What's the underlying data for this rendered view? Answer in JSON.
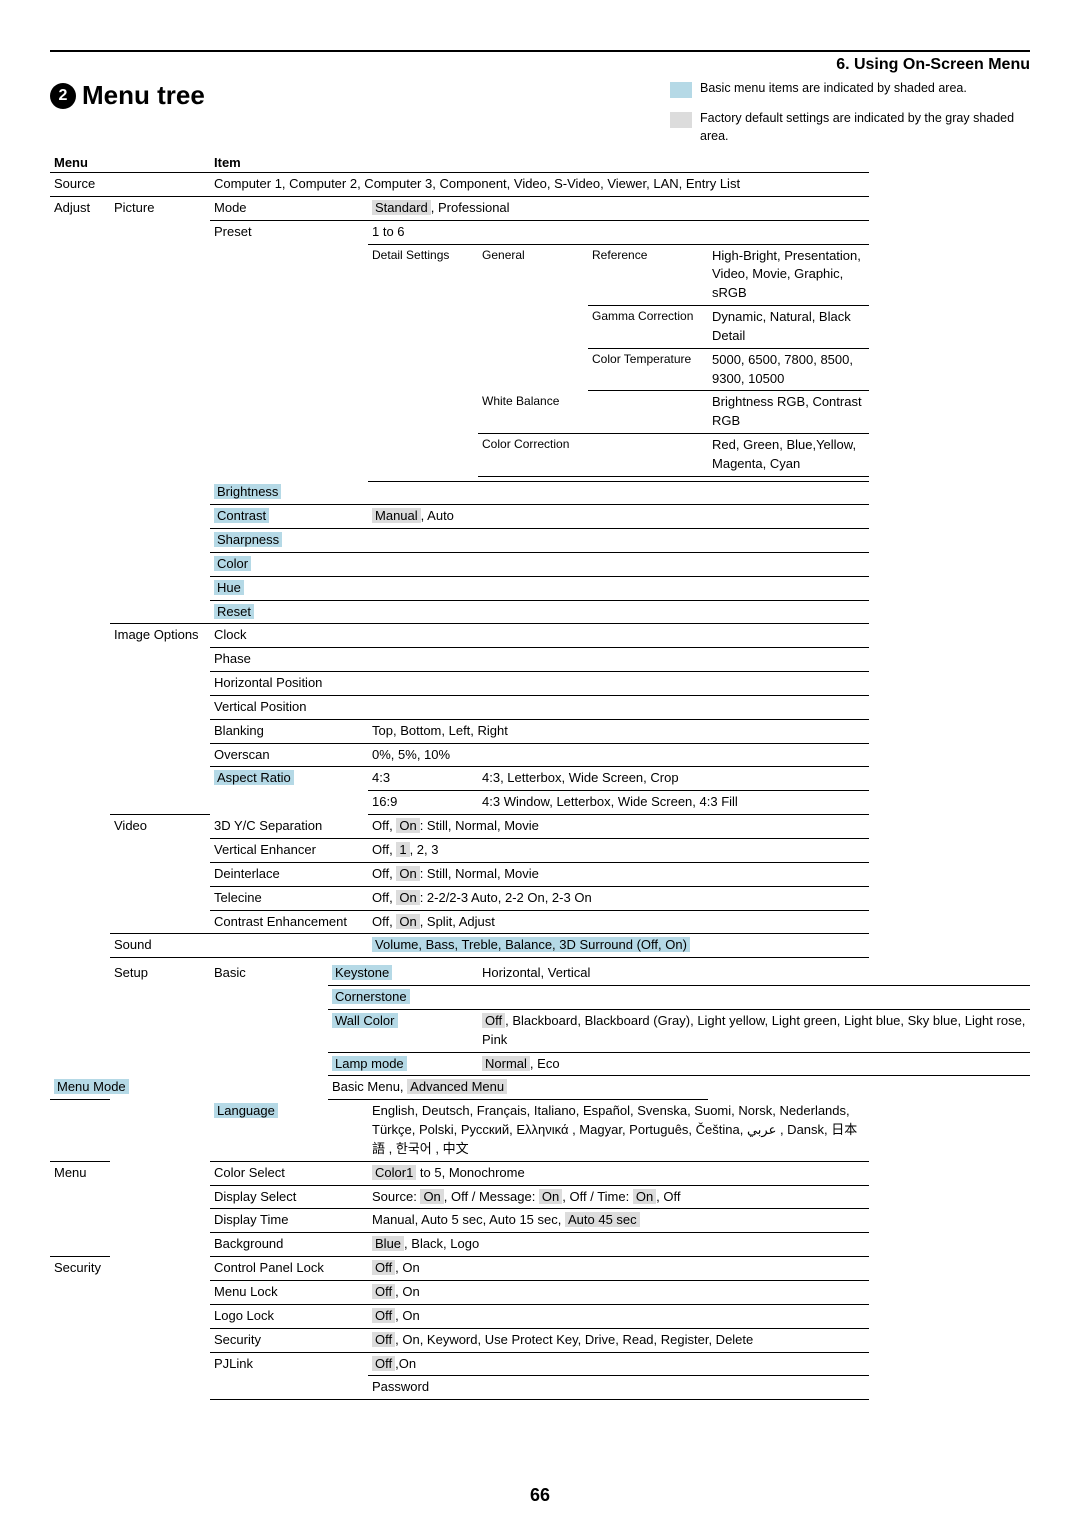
{
  "header": {
    "section": "6. Using On-Screen Menu",
    "circleNum": "2",
    "title": "Menu tree"
  },
  "legend": {
    "basic": "Basic menu items are indicated by shaded area.",
    "default": "Factory default settings are indicated by the gray shaded area."
  },
  "th": {
    "menu": "Menu",
    "item": "Item"
  },
  "menu": {
    "source": "Source",
    "adjust": "Adjust",
    "setup": "Setup"
  },
  "sub": {
    "picture": "Picture",
    "imageOptions": "Image Options",
    "video": "Video",
    "sound": "Sound",
    "basic": "Basic",
    "menu": "Menu",
    "security": "Security"
  },
  "source_values": "Computer 1, Computer 2, Computer 3, Component, Video, S-Video, Viewer, LAN, Entry List",
  "picture": {
    "mode": "Mode",
    "mode_vals": ", Professional",
    "mode_def": "Standard",
    "preset": "Preset",
    "preset_val": "1 to 6",
    "detail": "Detail Settings",
    "general": "General",
    "reference": "Reference",
    "reference_vals": "High-Bright, Presentation, Video, Movie, Graphic, sRGB",
    "gamma": "Gamma Correction",
    "gamma_vals": "Dynamic, Natural, Black Detail",
    "ct": "Color Temperature",
    "ct_vals": "5000, 6500, 7800, 8500, 9300, 10500",
    "wb": "White Balance",
    "wb_vals": "Brightness RGB, Contrast RGB",
    "cc": "Color Correction",
    "cc_vals": "Red, Green, Blue,Yellow, Magenta, Cyan",
    "brightness": "Brightness",
    "contrast": "Contrast",
    "contrast_def": "Manual",
    "contrast_rest": ", Auto",
    "sharpness": "Sharpness",
    "color": "Color",
    "hue": "Hue",
    "reset": "Reset"
  },
  "io": {
    "clock": "Clock",
    "phase": "Phase",
    "hpos": "Horizontal Position",
    "vpos": "Vertical Position",
    "blanking": "Blanking",
    "blanking_vals": "Top, Bottom, Left, Right",
    "overscan": "Overscan",
    "overscan_vals": "0%, 5%, 10%",
    "aspect": "Aspect Ratio",
    "aspect43": "4:3",
    "aspect43v": "4:3, Letterbox, Wide Screen, Crop",
    "aspect169": "16:9",
    "aspect169v": "4:3 Window, Letterbox, Wide Screen, 4:3 Fill"
  },
  "video": {
    "sep": "3D Y/C Separation",
    "sep_off": "Off, ",
    "sep_on": "On",
    "sep_rest": ": Still, Normal, Movie",
    "venh": "Vertical Enhancer",
    "venh_off": "Off, ",
    "venh_def": "1",
    "venh_rest": ", 2, 3",
    "deint": "Deinterlace",
    "deint_off": "Off, ",
    "deint_on": "On",
    "deint_rest": ": Still, Normal, Movie",
    "tele": "Telecine",
    "tele_off": "Off, ",
    "tele_on": "On",
    "tele_rest": ": 2-2/2-3 Auto, 2-2 On, 2-3 On",
    "cenh": "Contrast Enhancement",
    "cenh_off": "Off, ",
    "cenh_on": "On",
    "cenh_rest": ", Split, Adjust"
  },
  "sound_vals": "Volume, Bass, Treble, Balance, 3D Surround (Off, On)",
  "setup": {
    "keystone": "Keystone",
    "keystone_vals": "Horizontal, Vertical",
    "corner": "Cornerstone",
    "wall": "Wall Color",
    "wall_off": "Off",
    "wall_rest": ", Blackboard, Blackboard (Gray), Light yellow, Light green, Light blue, Sky blue, Light rose, Pink",
    "lamp": "Lamp mode",
    "lamp_def": "Normal",
    "lamp_rest": ", Eco",
    "menumode": "Menu Mode",
    "menumode_pre": "Basic Menu, ",
    "menumode_def": "Advanced Menu",
    "lang": "Language",
    "lang_vals": "English, Deutsch, Français, Italiano, Español, Svenska, Suomi, Norsk, Nederlands, Türkçe, Polski, Русский, Ελληνικά , Magyar, Português, Čeština, عربي , Dansk, 日本語 , 한국어 , 中文"
  },
  "m": {
    "csel": "Color Select",
    "csel_def": "Color1",
    "csel_rest": " to 5, Monochrome",
    "dsel": "Display Select",
    "dsel_s": "Source: ",
    "dsel_on1": "On",
    "dsel_r1": ", Off / Message: ",
    "dsel_on2": "On",
    "dsel_r2": ", Off / Time: ",
    "dsel_on3": "On",
    "dsel_r3": ", Off",
    "dtime": "Display Time",
    "dtime_pre": "Manual, Auto 5 sec, Auto 15 sec, ",
    "dtime_def": "Auto 45 sec",
    "bg": "Background",
    "bg_def": "Blue",
    "bg_rest": ", Black, Logo"
  },
  "sec": {
    "cpl": "Control Panel Lock",
    "ml": "Menu Lock",
    "ll": "Logo Lock",
    "sec": "Security",
    "sec_off": "Off",
    "sec_rest": ", On, Keyword, Use Protect Key, Drive, Read, Register, Delete",
    "pj": "PJLink",
    "pj_off": "Off",
    "pj_rest": ",On",
    "pwd": "Password",
    "off": "Off",
    "on_rest": ", On"
  },
  "page": "66"
}
